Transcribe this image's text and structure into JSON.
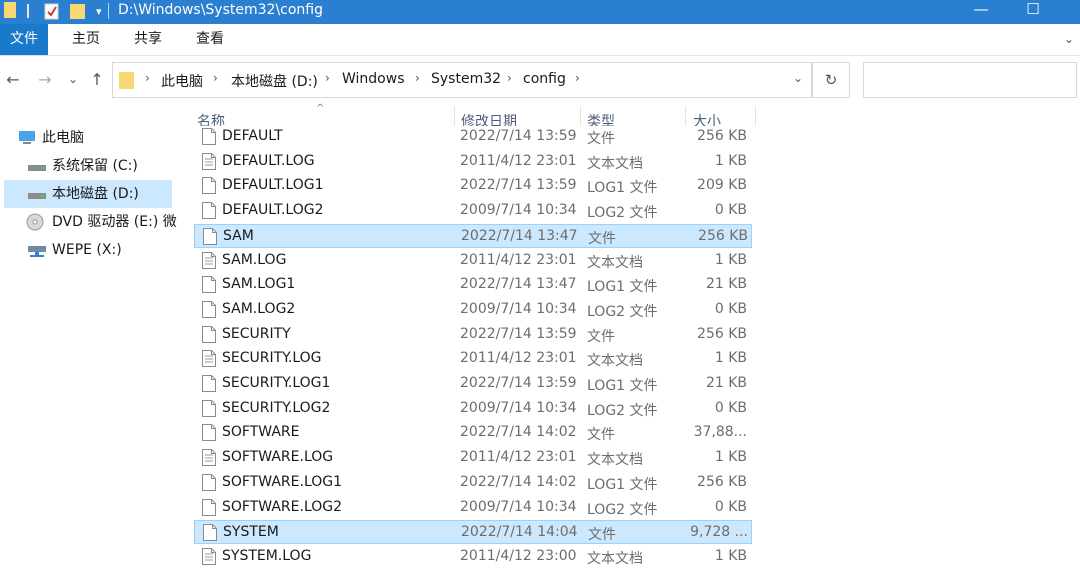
{
  "window": {
    "title": "D:\\Windows\\System32\\config",
    "minimize_glyph": "—",
    "maximize_glyph": "☐"
  },
  "ribbon": {
    "tabs": [
      "文件",
      "主页",
      "共享",
      "查看"
    ],
    "expand_glyph": "⌄"
  },
  "nav": {
    "back_glyph": "←",
    "forward_glyph": "→",
    "recent_glyph": "⌄",
    "up_glyph": "↑",
    "refresh_glyph": "↻",
    "breadcrumb": [
      "此电脑",
      "本地磁盘 (D:)",
      "Windows",
      "System32",
      "config"
    ],
    "separator": "›",
    "dropdown_glyph": "⌄"
  },
  "sidebar": {
    "items": [
      {
        "label": "此电脑",
        "icon": "computer-icon"
      },
      {
        "label": "系统保留 (C:)",
        "icon": "drive-icon"
      },
      {
        "label": "本地磁盘 (D:)",
        "icon": "drive-icon",
        "selected": true
      },
      {
        "label": "DVD 驱动器 (E:) 微",
        "icon": "dvd-icon"
      },
      {
        "label": "WEPE (X:)",
        "icon": "network-drive-icon"
      }
    ]
  },
  "columns": {
    "name": "名称",
    "date": "修改日期",
    "type": "类型",
    "size": "大小",
    "sort_glyph": "^"
  },
  "files": [
    {
      "name": "DEFAULT",
      "date": "2022/7/14 13:59",
      "type": "文件",
      "size": "256 KB",
      "icon": "file-icon"
    },
    {
      "name": "DEFAULT.LOG",
      "date": "2011/4/12 23:01",
      "type": "文本文档",
      "size": "1 KB",
      "icon": "text-file-icon"
    },
    {
      "name": "DEFAULT.LOG1",
      "date": "2022/7/14 13:59",
      "type": "LOG1 文件",
      "size": "209 KB",
      "icon": "file-icon"
    },
    {
      "name": "DEFAULT.LOG2",
      "date": "2009/7/14 10:34",
      "type": "LOG2 文件",
      "size": "0 KB",
      "icon": "file-icon"
    },
    {
      "name": "SAM",
      "date": "2022/7/14 13:47",
      "type": "文件",
      "size": "256 KB",
      "icon": "file-icon",
      "selected": true
    },
    {
      "name": "SAM.LOG",
      "date": "2011/4/12 23:01",
      "type": "文本文档",
      "size": "1 KB",
      "icon": "text-file-icon"
    },
    {
      "name": "SAM.LOG1",
      "date": "2022/7/14 13:47",
      "type": "LOG1 文件",
      "size": "21 KB",
      "icon": "file-icon"
    },
    {
      "name": "SAM.LOG2",
      "date": "2009/7/14 10:34",
      "type": "LOG2 文件",
      "size": "0 KB",
      "icon": "file-icon"
    },
    {
      "name": "SECURITY",
      "date": "2022/7/14 13:59",
      "type": "文件",
      "size": "256 KB",
      "icon": "file-icon"
    },
    {
      "name": "SECURITY.LOG",
      "date": "2011/4/12 23:01",
      "type": "文本文档",
      "size": "1 KB",
      "icon": "text-file-icon"
    },
    {
      "name": "SECURITY.LOG1",
      "date": "2022/7/14 13:59",
      "type": "LOG1 文件",
      "size": "21 KB",
      "icon": "file-icon"
    },
    {
      "name": "SECURITY.LOG2",
      "date": "2009/7/14 10:34",
      "type": "LOG2 文件",
      "size": "0 KB",
      "icon": "file-icon"
    },
    {
      "name": "SOFTWARE",
      "date": "2022/7/14 14:02",
      "type": "文件",
      "size": "37,88...",
      "icon": "file-icon"
    },
    {
      "name": "SOFTWARE.LOG",
      "date": "2011/4/12 23:01",
      "type": "文本文档",
      "size": "1 KB",
      "icon": "text-file-icon"
    },
    {
      "name": "SOFTWARE.LOG1",
      "date": "2022/7/14 14:02",
      "type": "LOG1 文件",
      "size": "256 KB",
      "icon": "file-icon"
    },
    {
      "name": "SOFTWARE.LOG2",
      "date": "2009/7/14 10:34",
      "type": "LOG2 文件",
      "size": "0 KB",
      "icon": "file-icon"
    },
    {
      "name": "SYSTEM",
      "date": "2022/7/14 14:04",
      "type": "文件",
      "size": "9,728 ...",
      "icon": "file-icon",
      "selected": true
    },
    {
      "name": "SYSTEM.LOG",
      "date": "2011/4/12 23:00",
      "type": "文本文档",
      "size": "1 KB",
      "icon": "text-file-icon"
    }
  ],
  "colors": {
    "titlebar": "#2b7fd0",
    "file_tab": "#1979ca",
    "selection": "#cce8ff",
    "selection_border": "#99d1ff",
    "folder": "#f8d775"
  }
}
